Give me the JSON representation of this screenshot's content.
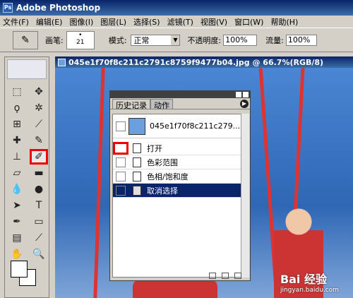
{
  "app": {
    "title": "Adobe Photoshop"
  },
  "menu": [
    "文件(F)",
    "编辑(E)",
    "图像(I)",
    "图层(L)",
    "选择(S)",
    "滤镜(T)",
    "视图(V)",
    "窗口(W)",
    "帮助(H)"
  ],
  "options": {
    "brush_label": "画笔:",
    "brush_size": "21",
    "mode_label": "模式:",
    "mode_value": "正常",
    "opacity_label": "不透明度:",
    "opacity_value": "100%",
    "flow_label": "流量:",
    "flow_value": "100%"
  },
  "document": {
    "title": "045e1f70f8c211c2791c8759f9477b04.jpg @ 66.7%(RGB/8)"
  },
  "history_panel": {
    "tabs": [
      "历史记录",
      "动作"
    ],
    "snapshot_name": "045e1f70f8c211c279...",
    "steps": [
      "打开",
      "色彩范围",
      "色相/饱和度",
      "取消选择"
    ],
    "selected_index": 3
  },
  "watermark": {
    "brand": "Bai 经验",
    "url": "jingyan.baidu.com"
  }
}
